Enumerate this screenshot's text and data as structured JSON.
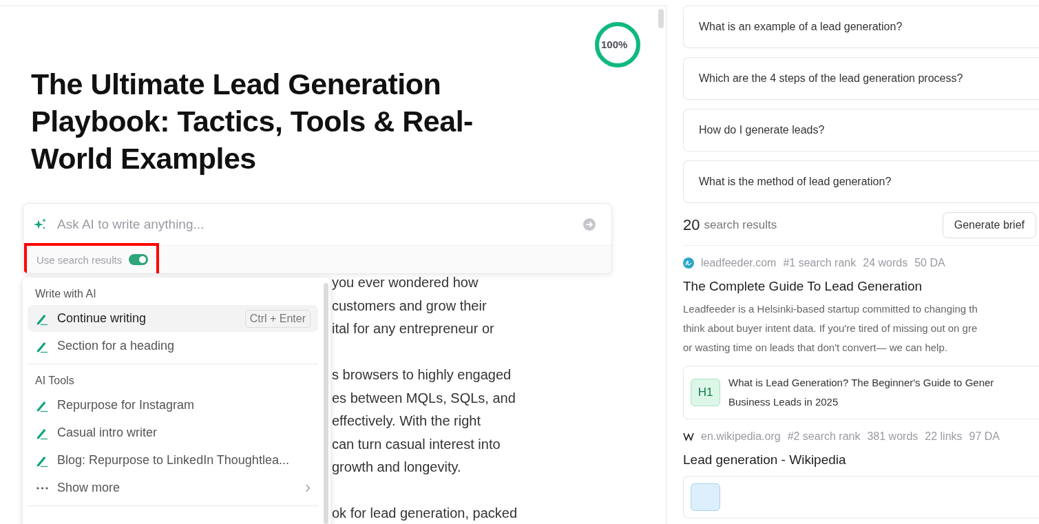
{
  "editor": {
    "progress": {
      "reading": "100%",
      "level": 1
    },
    "title": "The Ultimate Lead Generation Playbook: Tactics, Tools & Real-World Examples",
    "ai_prompt": {
      "placeholder": "Ask AI to write anything...",
      "use_search_results": {
        "label": "Use search results",
        "on": true
      }
    },
    "body_paragraphs": [
      [
        "you ever wondered how",
        "customers and grow their",
        "ital for any entrepreneur or"
      ],
      [
        "s browsers to highly engaged",
        "es between MQLs, SQLs, and",
        "effectively. With the right",
        "can turn casual interest into",
        "growth and longevity."
      ],
      [
        "ok for lead generation, packed"
      ]
    ],
    "ai_menu": [
      {
        "heading": "Write with AI",
        "items": [
          {
            "kind": "action",
            "label": "Continue writing",
            "shortcut": "Ctrl + Enter",
            "selected": true
          },
          {
            "kind": "action",
            "label": "Section for a heading",
            "selected": false
          }
        ]
      },
      {
        "heading": "AI Tools",
        "items": [
          {
            "kind": "action",
            "label": "Repurpose for Instagram",
            "selected": false
          },
          {
            "kind": "action",
            "label": "Casual intro writer",
            "selected": false
          },
          {
            "kind": "action",
            "label": "Blog: Repurpose to LinkedIn Thoughtlea...",
            "selected": false
          },
          {
            "kind": "more",
            "label": "Show more",
            "selected": false
          }
        ]
      }
    ]
  },
  "sidebar": {
    "questions": [
      "What is an example of a lead generation?",
      "Which are the 4 steps of the lead generation process?",
      "How do I generate leads?",
      "What is the method of lead generation?"
    ],
    "results_count": "20",
    "results_label": "search results",
    "generate_button": "Generate brief",
    "results": [
      {
        "domain": "leadfeeder.com",
        "meta": [
          "#1 search rank",
          "24 words",
          "50 DA"
        ],
        "title": "The Complete Guide To Lead Generation",
        "description": [
          "Leadfeeder is a Helsinki-based startup committed to changing th",
          "think about buyer intent data. If you're tired of missing out on gre",
          "or wasting time on leads that don't convert— we can help."
        ],
        "heading": {
          "tag": "H1",
          "lines": [
            "What is Lead Generation? The Beginner's Guide to Gener",
            "Business Leads in 2025"
          ]
        }
      },
      {
        "domain": "en.wikipedia.org",
        "meta": [
          "#2 search rank",
          "381 words",
          "22 links",
          "97 DA"
        ],
        "title": "Lead generation - Wikipedia"
      }
    ]
  }
}
